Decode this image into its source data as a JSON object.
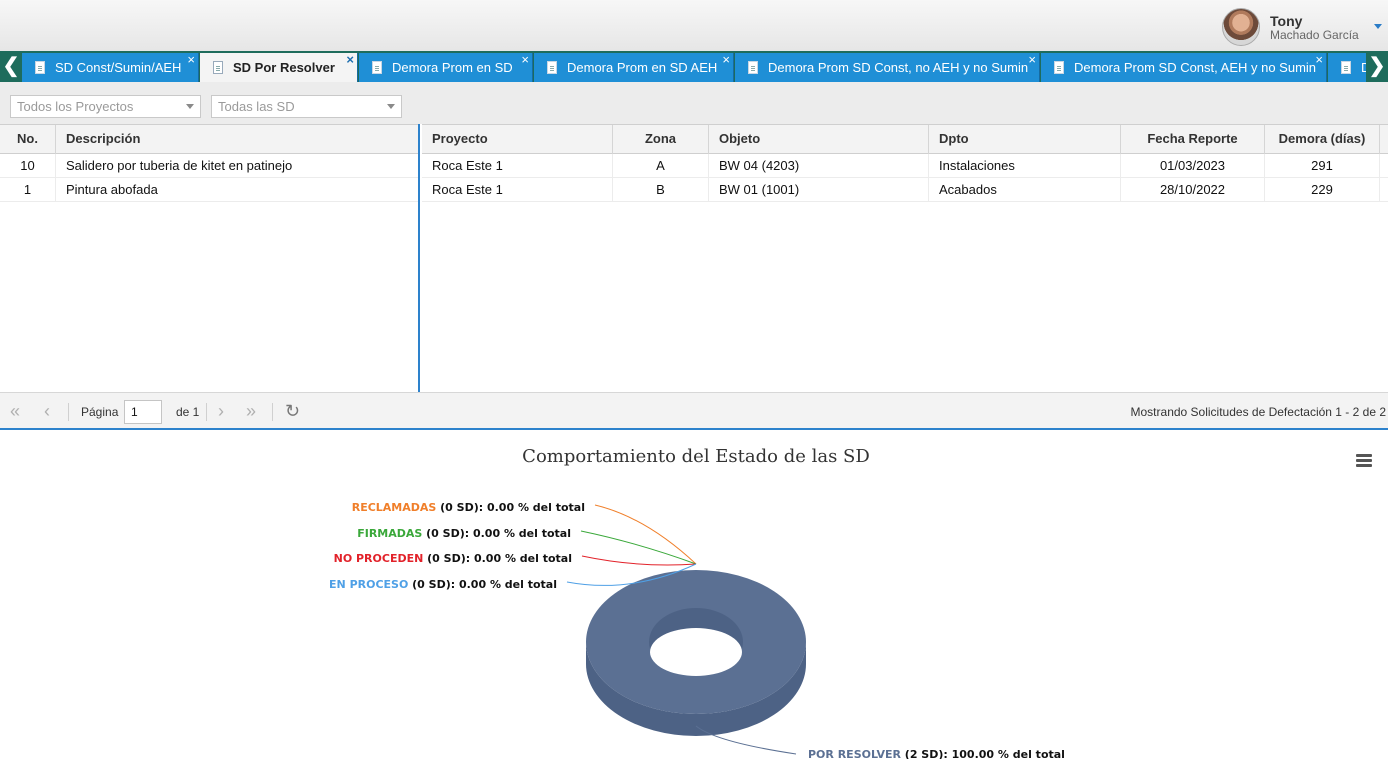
{
  "user": {
    "first_name": "Tony",
    "last_name": "Machado García"
  },
  "tabs": [
    {
      "label": "SD Const/Sumin/AEH",
      "active": false
    },
    {
      "label": "SD Por Resolver",
      "active": true
    },
    {
      "label": "Demora Prom en SD",
      "active": false
    },
    {
      "label": "Demora Prom en SD AEH",
      "active": false
    },
    {
      "label": "Demora Prom SD Const, no AEH y no Sumin",
      "active": false
    },
    {
      "label": "Demora Prom SD Const, AEH y no Sumin",
      "active": false
    },
    {
      "label": "D",
      "active": false
    }
  ],
  "tab_close_glyph": "×",
  "tab_scroll": {
    "left": "❮",
    "right": "❯"
  },
  "filters": {
    "projects_placeholder": "Todos los Proyectos",
    "sd_placeholder": "Todas las SD"
  },
  "left_grid": {
    "headers": {
      "no": "No.",
      "descripcion": "Descripción"
    },
    "rows": [
      {
        "no": "10",
        "descripcion": "Salidero por tuberia de kitet en patinejo"
      },
      {
        "no": "1",
        "descripcion": "Pintura abofada"
      }
    ]
  },
  "right_grid": {
    "headers": {
      "proyecto": "Proyecto",
      "zona": "Zona",
      "objeto": "Objeto",
      "dpto": "Dpto",
      "fecha": "Fecha Reporte",
      "demora": "Demora (días)"
    },
    "rows": [
      {
        "proyecto": "Roca Este 1",
        "zona": "A",
        "objeto": "BW 04 (4203)",
        "dpto": "Instalaciones",
        "fecha": "01/03/2023",
        "demora": "291"
      },
      {
        "proyecto": "Roca Este 1",
        "zona": "B",
        "objeto": "BW 01 (1001)",
        "dpto": "Acabados",
        "fecha": "28/10/2022",
        "demora": "229"
      }
    ]
  },
  "pager": {
    "first": "«",
    "prev": "‹",
    "page_label": "Página",
    "page_value": "1",
    "of_label": "de 1",
    "next": "›",
    "last": "»",
    "refresh": "↻",
    "info": "Mostrando Solicitudes de Defectación 1 - 2 de 2"
  },
  "chart_data": {
    "type": "pie",
    "title": "Comportamiento del Estado de las SD",
    "series": [
      {
        "name": "RECLAMADAS",
        "count_label": "(0 SD): 0.00 % del total",
        "value": 0,
        "color": "#f07f2a"
      },
      {
        "name": "FIRMADAS",
        "count_label": "(0 SD): 0.00 % del total",
        "value": 0,
        "color": "#3aa83a"
      },
      {
        "name": "NO PROCEDEN",
        "count_label": "(0 SD): 0.00 % del total",
        "value": 0,
        "color": "#e2222a"
      },
      {
        "name": "EN PROCESO",
        "count_label": "(0 SD): 0.00 % del total",
        "value": 0,
        "color": "#4fa0e6"
      },
      {
        "name": "POR RESOLVER",
        "count_label": "(2 SD): 100.00 % del total",
        "value": 2,
        "color": "#5b7093"
      }
    ],
    "donut": true,
    "three_d": true
  }
}
